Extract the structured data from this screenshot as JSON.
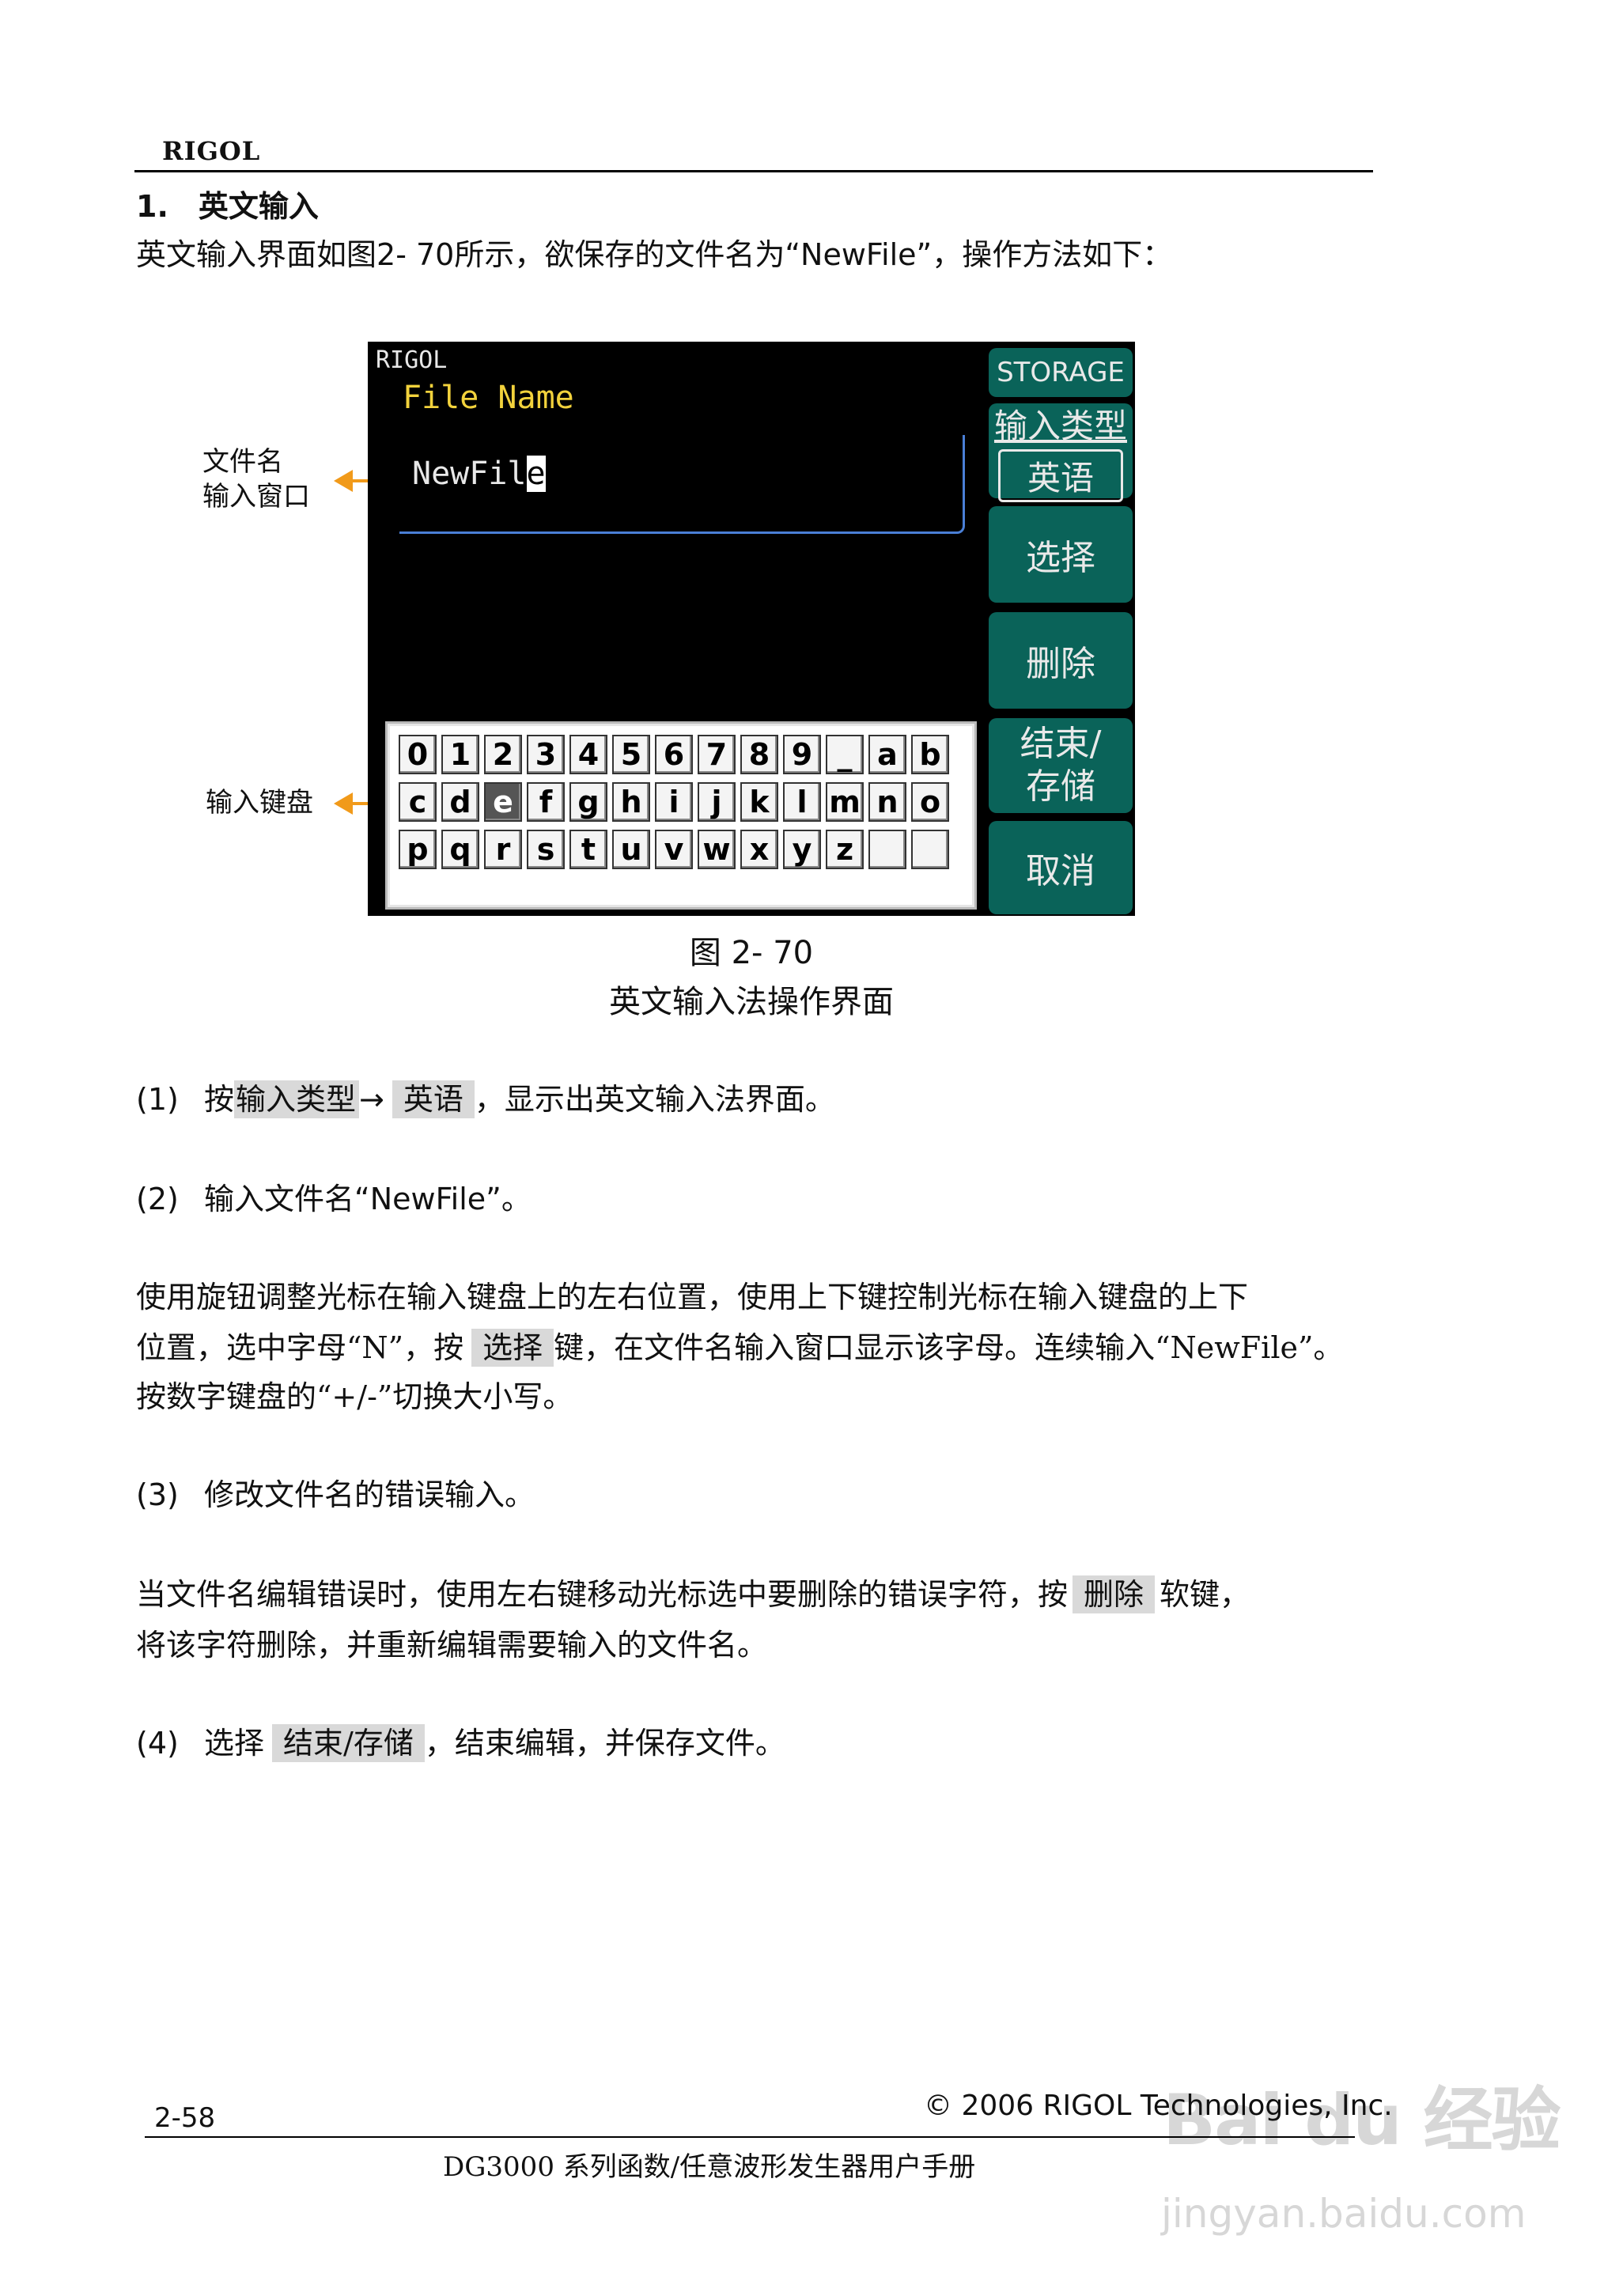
{
  "header": {
    "brand": "RIGOL"
  },
  "section": {
    "number": "1.",
    "title": "英文输入"
  },
  "intro": {
    "text_a": "英文输入界面如图",
    "fig_ref": "2- 70",
    "text_b": "所示，欲保存的文件名为",
    "filename": "“NewFile”",
    "text_c": "，操作方法如下："
  },
  "screen": {
    "brand": "RIGOL",
    "title": "File Name",
    "filename_before_cursor": "NewFil",
    "filename_cursor_char": "e",
    "softkeys": {
      "storage": "STORAGE",
      "input_type": "输入类型",
      "input_type_value": "英语",
      "select": "选择",
      "delete": "删除",
      "finish_line1": "结束/",
      "finish_line2": "存储",
      "cancel": "取消"
    },
    "keyboard_rows": [
      [
        "0",
        "1",
        "2",
        "3",
        "4",
        "5",
        "6",
        "7",
        "8",
        "9",
        "_",
        "a",
        "b"
      ],
      [
        "c",
        "d",
        "e",
        "f",
        "g",
        "h",
        "i",
        "j",
        "k",
        "l",
        "m",
        "n",
        "o"
      ],
      [
        "p",
        "q",
        "r",
        "s",
        "t",
        "u",
        "v",
        "w",
        "x",
        "y",
        "z",
        "",
        ""
      ]
    ],
    "selected_key": "e"
  },
  "callouts": {
    "filename_window_line1": "文件名",
    "filename_window_line2": "输入窗口",
    "keyboard": "输入键盘"
  },
  "figure": {
    "label": "图 2- 70",
    "caption": "英文输入法操作界面"
  },
  "steps": {
    "s1": {
      "num": "(1)",
      "pre": "按",
      "key1": "输入类型",
      "arrow": "→",
      "key2": "英语",
      "post": "，显示出英文输入法界面。"
    },
    "s2": {
      "num": "(2)",
      "text": "输入文件名",
      "value": "“NewFile”",
      "post": "。"
    },
    "s2_body_line1": "使用旋钮调整光标在输入键盘上的左右位置，使用上下键控制光标在输入键盘的上下",
    "s2_body_line2_a": "位置，选中字母“N”，按",
    "s2_body_key": "选择",
    "s2_body_line2_b": "键，在文件名输入窗口显示该字母。连续输入“NewFile”。",
    "s2_body_line3": "按数字键盘的“+/-”切换大小写。",
    "s3": {
      "num": "(3)",
      "text": "修改文件名的错误输入。"
    },
    "s3_body_line1_a": "当文件名编辑错误时，使用左右键移动光标选中要删除的错误字符，按",
    "s3_body_key": "删除",
    "s3_body_line1_b": "软键，",
    "s3_body_line2": "将该字符删除，并重新编辑需要输入的文件名。",
    "s4": {
      "num": "(4)",
      "pre": "选择",
      "key": "结束/存储",
      "post": "，结束编辑，并保存文件。"
    }
  },
  "footer": {
    "page": "2-58",
    "copyright": "© 2006 RIGOL Technologies, Inc.",
    "manual": "DG3000 系列函数/任意波形发生器用户手册"
  },
  "watermark": {
    "main": "Bai du 经验",
    "url": "jingyan.baidu.com"
  }
}
